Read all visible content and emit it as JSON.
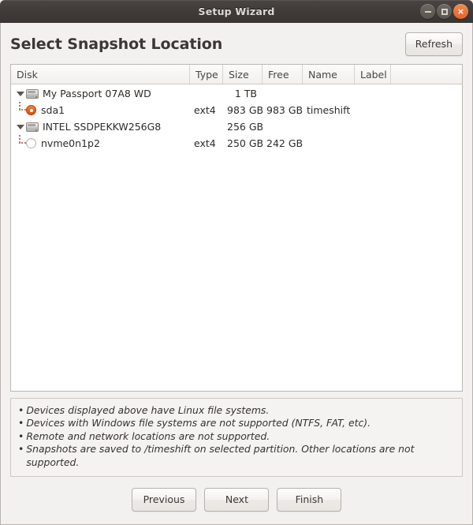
{
  "window": {
    "title": "Setup Wizard",
    "controls": {
      "minimize": "minimize",
      "maximize": "maximize",
      "close": "×"
    }
  },
  "header": {
    "title": "Select Snapshot Location",
    "refresh_label": "Refresh"
  },
  "colors": {
    "accent": "#e4642a",
    "selected_radio": "#d94f12",
    "titlebar": "#403b38",
    "background": "#f2f1f0",
    "tree_line": "#b9775e"
  },
  "tree": {
    "columns": [
      {
        "key": "disk",
        "label": "Disk"
      },
      {
        "key": "type",
        "label": "Type"
      },
      {
        "key": "size",
        "label": "Size"
      },
      {
        "key": "free",
        "label": "Free"
      },
      {
        "key": "name",
        "label": "Name"
      },
      {
        "key": "label",
        "label": "Label"
      },
      {
        "key": "pad",
        "label": ""
      }
    ],
    "rows": [
      {
        "kind": "disk",
        "expanded": true,
        "icon": "hard-drive-icon",
        "disk": "My Passport 07A8 WD",
        "type": "",
        "size": "1 TB",
        "free": "",
        "name": "",
        "label": ""
      },
      {
        "kind": "partition",
        "selected": true,
        "icon": "radio-selected-icon",
        "disk": "sda1",
        "type": "ext4",
        "size": "983 GB",
        "free": "983 GB",
        "name": "timeshift",
        "label": ""
      },
      {
        "kind": "disk",
        "expanded": true,
        "icon": "hard-drive-icon",
        "disk": "INTEL SSDPEKKW256G8",
        "type": "",
        "size": "256 GB",
        "free": "",
        "name": "",
        "label": ""
      },
      {
        "kind": "partition",
        "selected": false,
        "icon": "radio-unselected-icon",
        "disk": "nvme0n1p2",
        "type": "ext4",
        "size": "250 GB",
        "free": "242 GB",
        "name": "",
        "label": ""
      }
    ]
  },
  "notes": {
    "bullet": "•",
    "lines": [
      "Devices displayed above have Linux file systems.",
      "Devices with Windows file systems are not supported (NTFS, FAT, etc).",
      "Remote and network locations are not supported.",
      "Snapshots are saved to /timeshift on selected partition. Other locations are not supported."
    ]
  },
  "footer": {
    "previous_label": "Previous",
    "next_label": "Next",
    "finish_label": "Finish"
  }
}
